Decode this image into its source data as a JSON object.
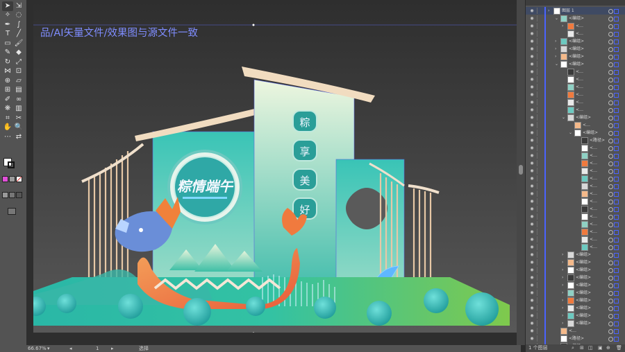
{
  "canvas": {
    "overlay_text": "品/AI矢量文件/效果图与源文件一致",
    "title_text": "粽情端午",
    "vertical_chars": [
      "粽",
      "享",
      "美",
      "好"
    ]
  },
  "status": {
    "zoom": "66.67%",
    "artboard_no": "1",
    "selection_label": "选择"
  },
  "layers_panel": {
    "top_layer": "图层 1",
    "group_label": "<编组>",
    "path_label": "<路径>",
    "footer_count": "1 个图层"
  },
  "colors": {
    "accent": "#7f8dff",
    "selection": "#4a63ff",
    "teal": "#2bbfae",
    "orange": "#f07a3e"
  },
  "tools": [
    "select-icon",
    "direct-select-icon",
    "magic-wand-icon",
    "lasso-icon",
    "pen-icon",
    "curvature-icon",
    "type-icon",
    "line-icon",
    "rectangle-icon",
    "paintbrush-icon",
    "shaper-icon",
    "eraser-icon",
    "rotate-icon",
    "scale-icon",
    "width-icon",
    "free-transform-icon",
    "shape-builder-icon",
    "perspective-icon",
    "mesh-icon",
    "gradient-icon",
    "eyedropper-icon",
    "blend-icon",
    "symbol-sprayer-icon",
    "graph-icon",
    "artboard-icon",
    "slice-icon",
    "hand-icon",
    "zoom-icon"
  ]
}
